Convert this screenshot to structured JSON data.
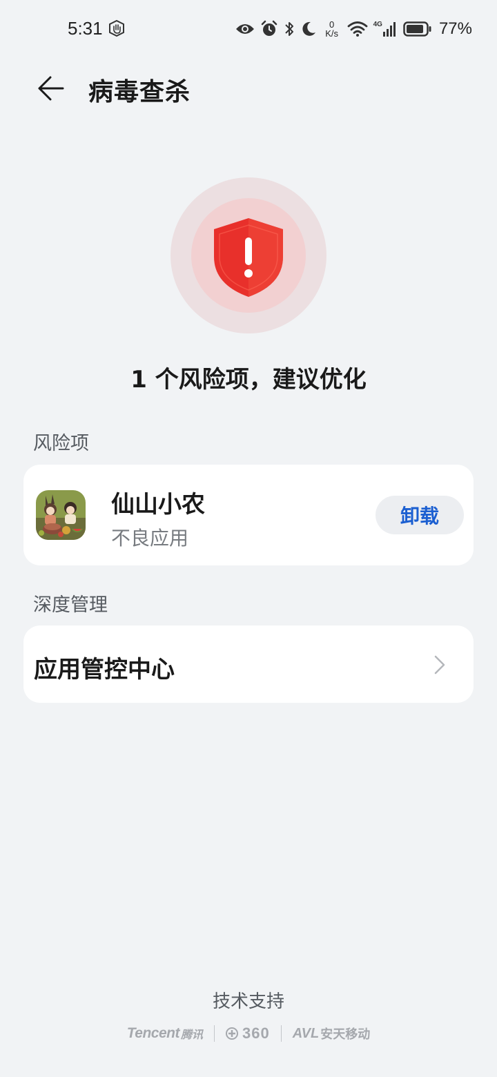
{
  "status_bar": {
    "time": "5:31",
    "net_speed_value": "0",
    "net_speed_unit": "K/s",
    "network_type": "4G",
    "battery_percent": "77%"
  },
  "header": {
    "title": "病毒查杀"
  },
  "scan_result": {
    "summary": "1 个风险项，建议优化",
    "status_color": "#e8302b"
  },
  "risk_section": {
    "label": "风险项",
    "items": [
      {
        "app_name": "仙山小农",
        "description": "不良应用",
        "action_label": "卸载"
      }
    ]
  },
  "manage_section": {
    "label": "深度管理",
    "items": [
      {
        "label": "应用管控中心"
      }
    ]
  },
  "footer": {
    "title": "技术支持",
    "partners": {
      "tencent_en": "Tencent",
      "tencent_cn": "腾讯",
      "qihoo": "360",
      "antiy_mark": "AVL",
      "antiy_cn": "安天移动"
    }
  },
  "colors": {
    "background": "#f1f3f5",
    "accent_blue": "#1b5fd1",
    "danger_red": "#e8302b"
  }
}
